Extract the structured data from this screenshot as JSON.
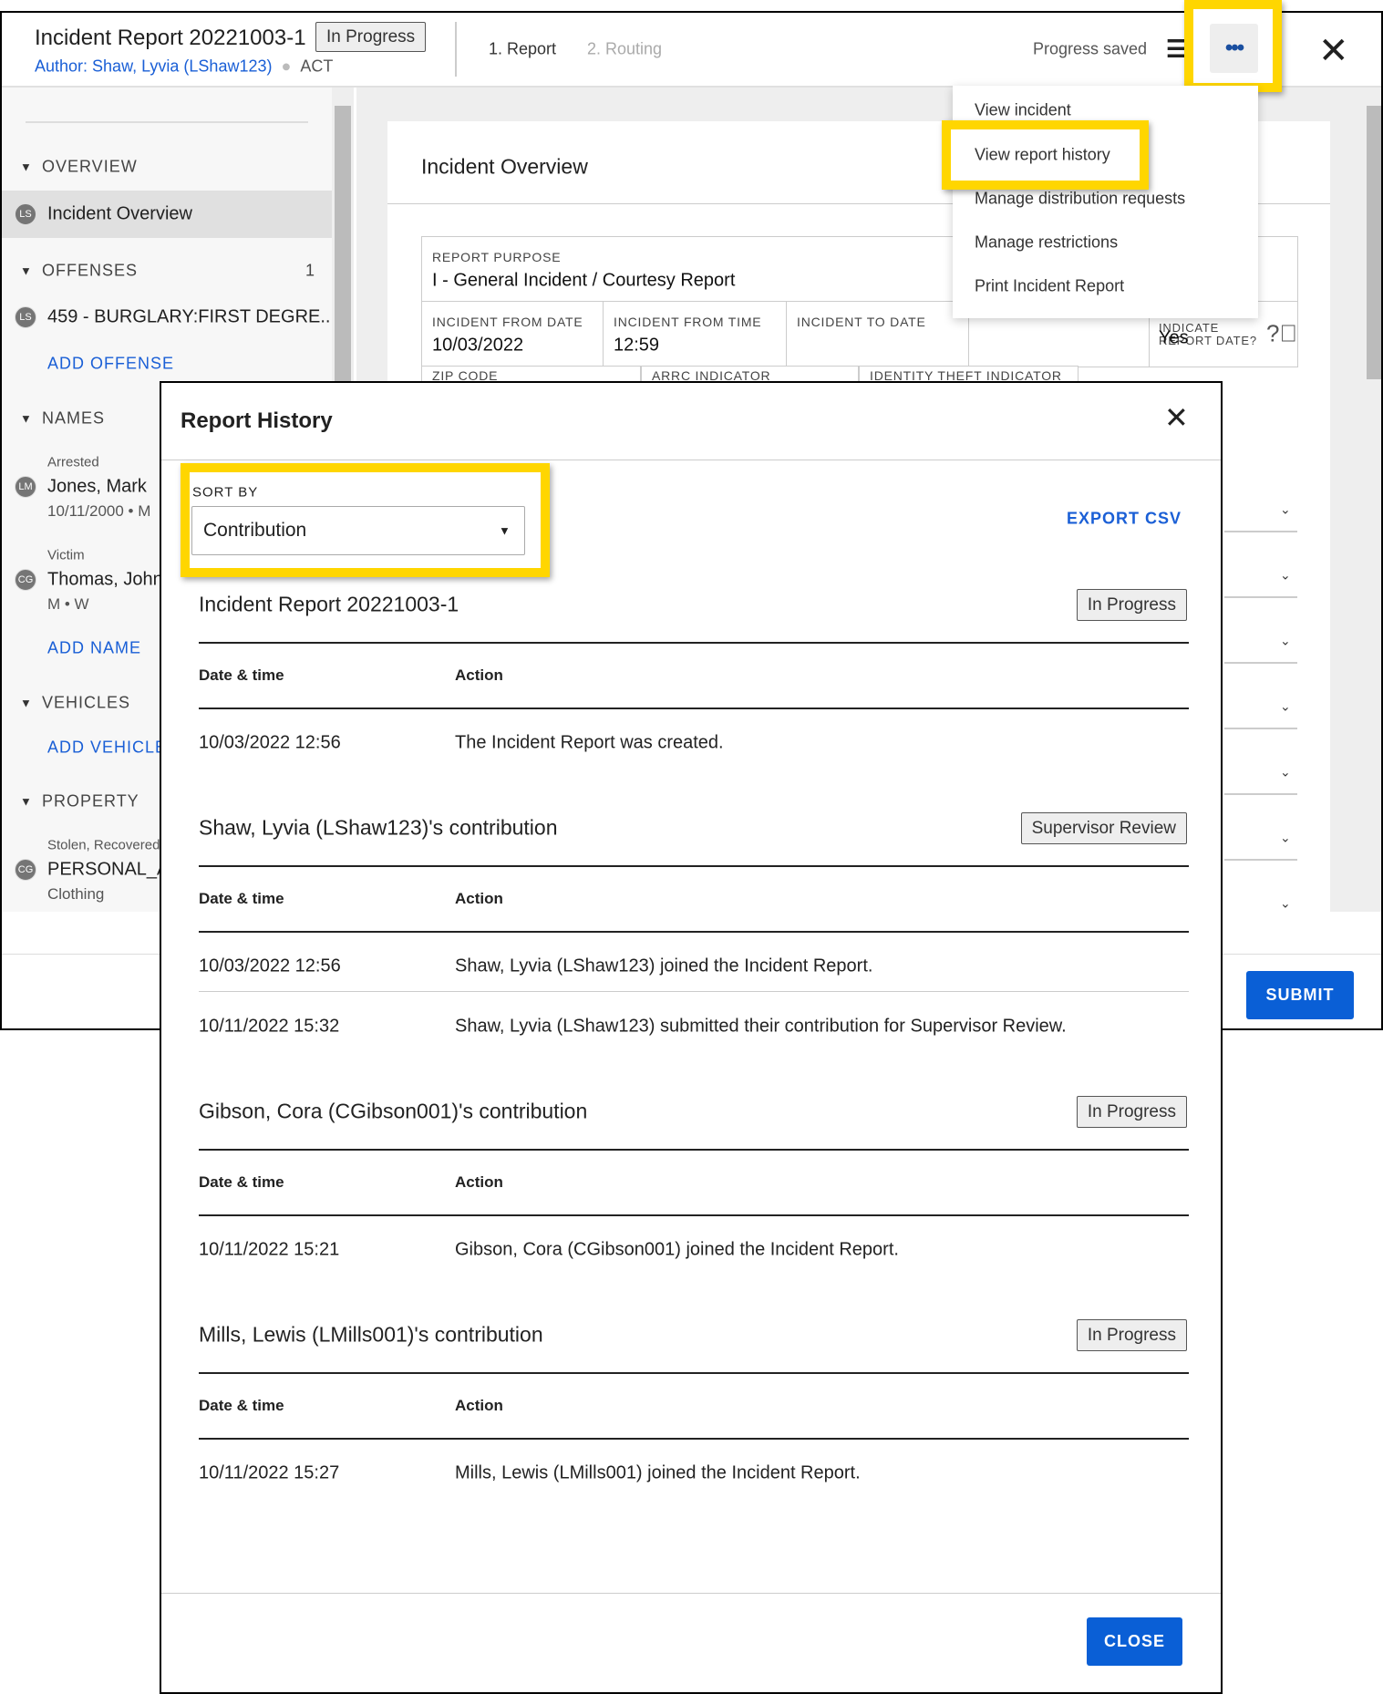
{
  "header": {
    "title": "Incident Report 20221003-1",
    "status": "In Progress",
    "author": "Author: Shaw, Lyvia (LShaw123)",
    "agency": "ACT",
    "steps": [
      "1. Report",
      "2. Routing"
    ],
    "progress": "Progress saved",
    "list_icon": "list-icon",
    "more_icon": "more-horizontal-icon",
    "close_icon": "close-icon"
  },
  "sidebar": {
    "overview": {
      "label": "OVERVIEW",
      "item": "Incident Overview",
      "avatar": "LS"
    },
    "offenses": {
      "label": "OFFENSES",
      "count": "1",
      "item": "459 - BURGLARY:FIRST DEGRE...",
      "avatar": "LS",
      "add": "ADD OFFENSE"
    },
    "names": {
      "label": "NAMES",
      "items": [
        {
          "role": "Arrested",
          "name": "Jones, Mark",
          "detail": "10/11/2000 • M",
          "avatar": "LM"
        },
        {
          "role": "Victim",
          "name": "Thomas, John",
          "detail": "M • W",
          "avatar": "CG"
        }
      ],
      "add": "ADD NAME"
    },
    "vehicles": {
      "label": "VEHICLES",
      "add": "ADD VEHICLE"
    },
    "property": {
      "label": "PROPERTY",
      "role": "Stolen, Recovered",
      "name": "PERSONAL_A",
      "detail": "Clothing",
      "avatar": "CG"
    }
  },
  "main": {
    "card_title": "Incident Overview",
    "report_purpose_label": "REPORT PURPOSE",
    "report_purpose": "I - General Incident / Courtesy Report",
    "from_date_label": "INCIDENT FROM DATE",
    "from_date": "10/03/2022",
    "from_time_label": "INCIDENT FROM TIME",
    "from_time": "12:59",
    "to_date_label": "INCIDENT TO DATE",
    "indicate_label": "INDICATE REPORT DATE?",
    "indicate_value": "Yes",
    "zip_label": "ZIP CODE",
    "arrc_label": "ARRC INDICATOR",
    "identity_label": "IDENTITY THEFT INDICATOR",
    "submit": "SUBMIT"
  },
  "menu": {
    "items": [
      "View incident",
      "View report history",
      "Manage distribution requests",
      "Manage restrictions",
      "Print Incident Report"
    ],
    "highlighted": "View report history"
  },
  "modal": {
    "title": "Report History",
    "sort_label": "SORT BY",
    "sort_value": "Contribution",
    "export": "EXPORT CSV",
    "col_date": "Date & time",
    "col_action": "Action",
    "close": "CLOSE",
    "sections": [
      {
        "title": "Incident Report 20221003-1",
        "status": "In Progress",
        "rows": [
          {
            "date": "10/03/2022 12:56",
            "action": "The Incident Report was created."
          }
        ]
      },
      {
        "title": "Shaw, Lyvia (LShaw123)'s contribution",
        "status": "Supervisor Review",
        "rows": [
          {
            "date": "10/03/2022 12:56",
            "action": "Shaw, Lyvia (LShaw123) joined the Incident Report."
          },
          {
            "date": "10/11/2022 15:32",
            "action": "Shaw, Lyvia (LShaw123) submitted their contribution for Supervisor Review."
          }
        ]
      },
      {
        "title": "Gibson, Cora (CGibson001)'s contribution",
        "status": "In Progress",
        "rows": [
          {
            "date": "10/11/2022 15:21",
            "action": "Gibson, Cora (CGibson001) joined the Incident Report."
          }
        ]
      },
      {
        "title": "Mills, Lewis (LMills001)'s contribution",
        "status": "In Progress",
        "rows": [
          {
            "date": "10/11/2022 15:27",
            "action": "Mills, Lewis (LMills001) joined the Incident Report."
          }
        ]
      }
    ]
  },
  "colors": {
    "accent": "#1a5fd6",
    "highlight": "#ffd600",
    "submit": "#0a5fd6"
  }
}
